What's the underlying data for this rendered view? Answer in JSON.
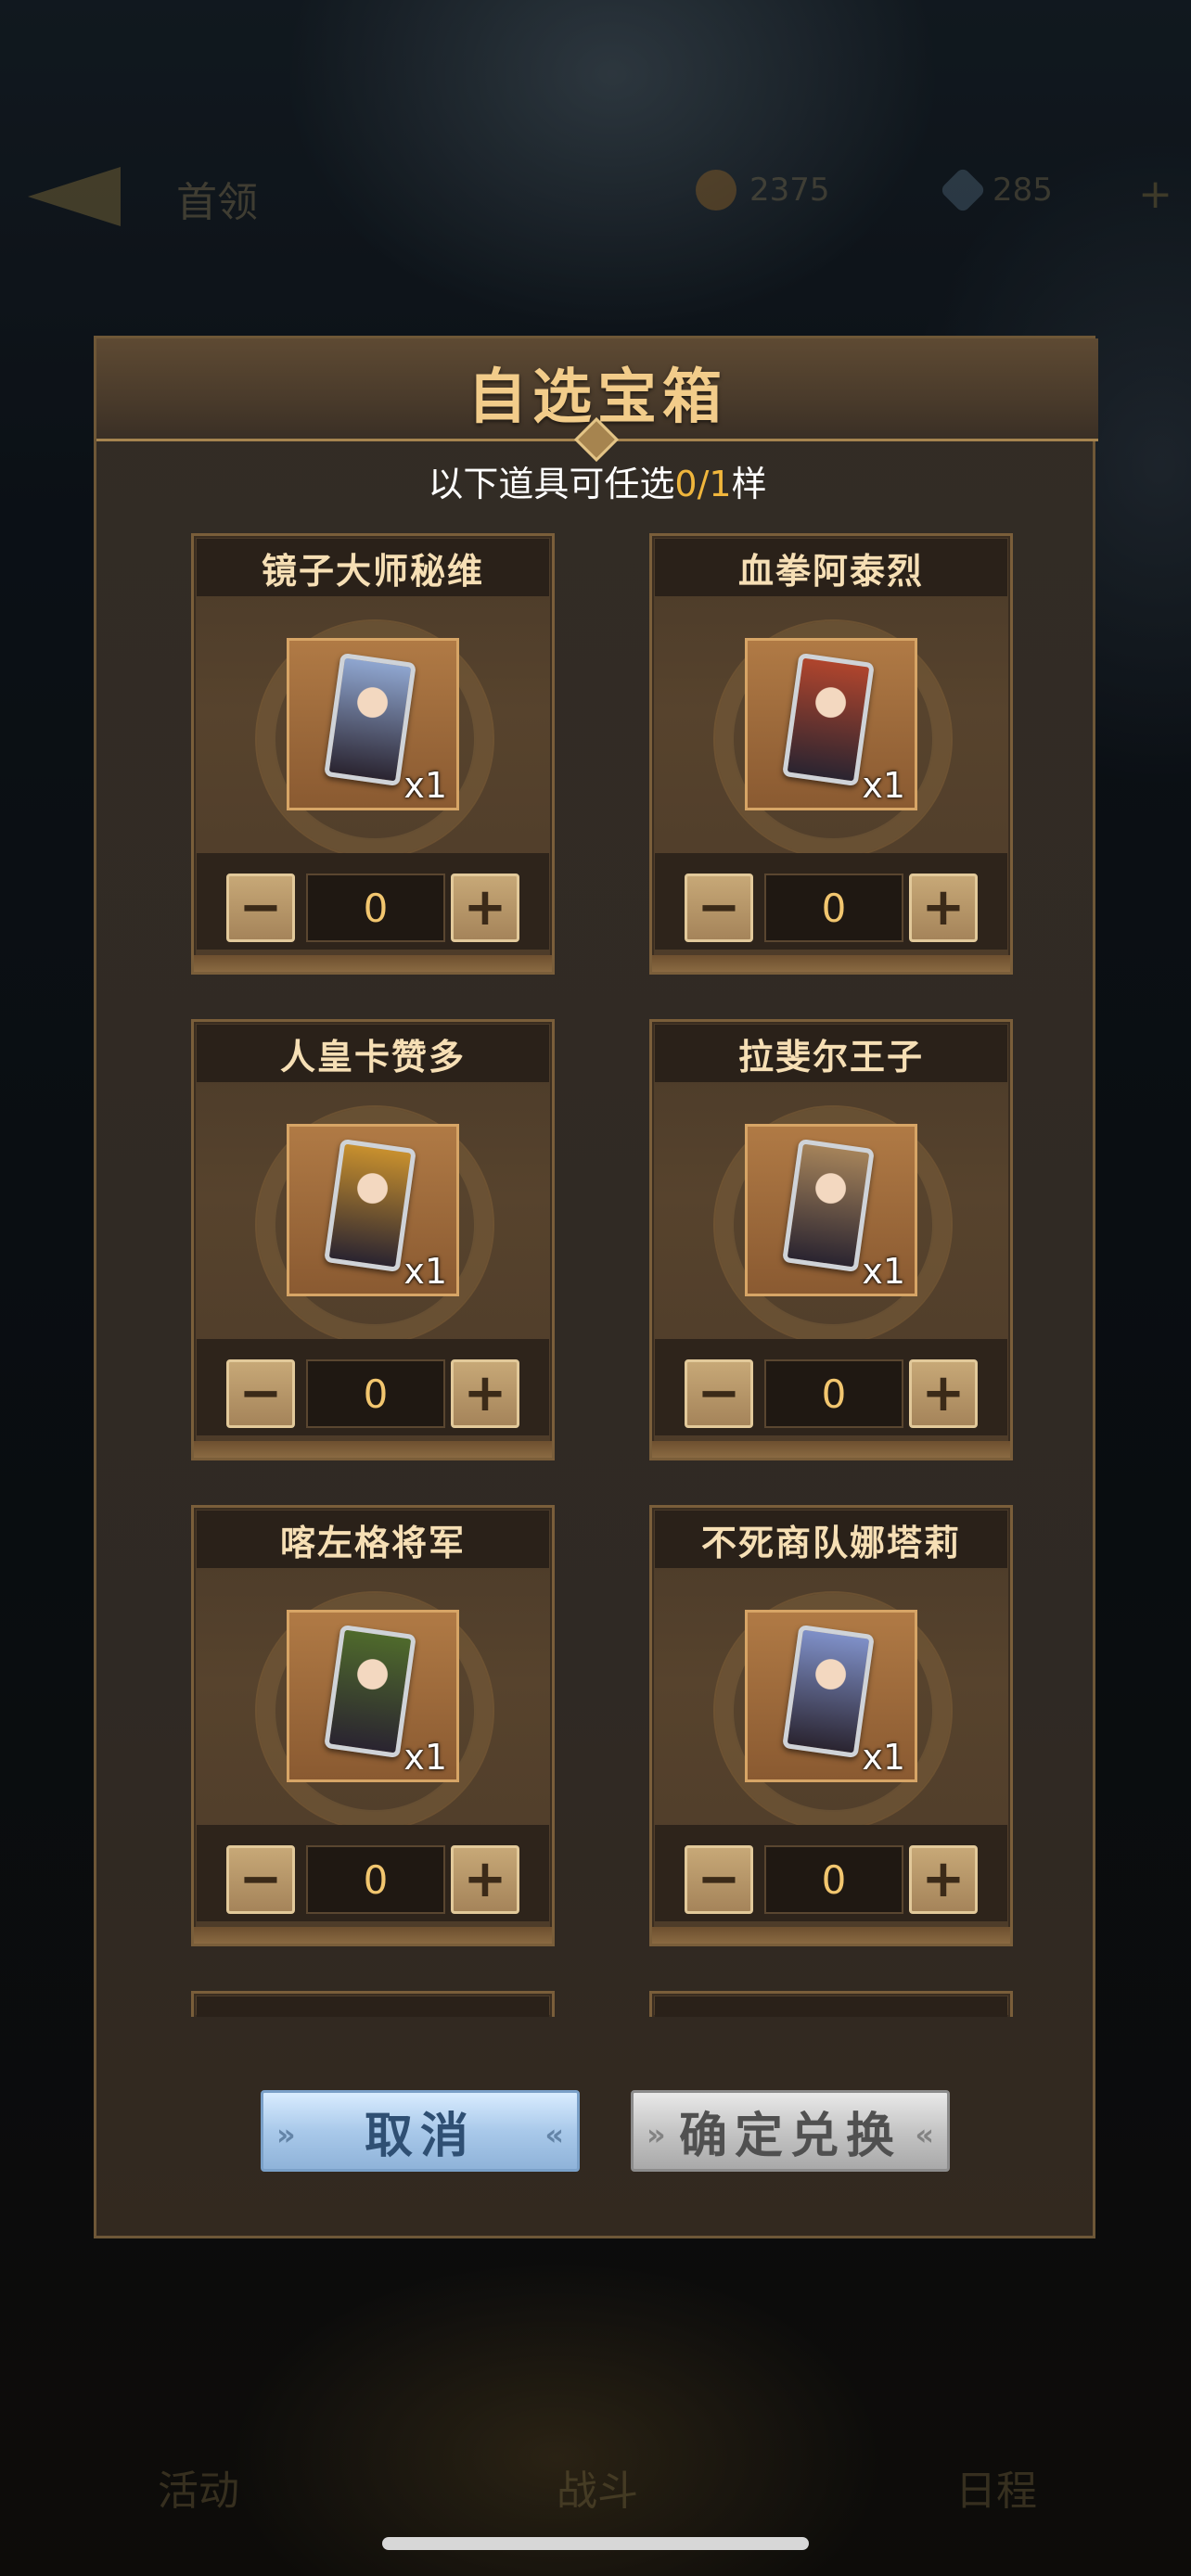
{
  "background": {
    "back_label": "首领",
    "resources": [
      "2375",
      "285"
    ],
    "nav": [
      "活动",
      "战斗",
      "日程"
    ]
  },
  "dialog": {
    "title": "自选宝箱",
    "subtitle_prefix": "以下道具可任选",
    "subtitle_count": "0/1",
    "subtitle_suffix": "样",
    "items": [
      {
        "name": "镜子大师秘维",
        "qty": "x1",
        "value": "0",
        "art": "#8fa6d0"
      },
      {
        "name": "血拳阿泰烈",
        "qty": "x1",
        "value": "0",
        "art": "#b0452d"
      },
      {
        "name": "人皇卡赞多",
        "qty": "x1",
        "value": "0",
        "art": "#c8902e"
      },
      {
        "name": "拉斐尔王子",
        "qty": "x1",
        "value": "0",
        "art": "#a5835a"
      },
      {
        "name": "喀左格将军",
        "qty": "x1",
        "value": "0",
        "art": "#4f6a2c"
      },
      {
        "name": "不死商队娜塔莉",
        "qty": "x1",
        "value": "0",
        "art": "#7f90c8"
      }
    ],
    "minus_label": "−",
    "plus_label": "+",
    "cancel_label": "取消",
    "confirm_label": "确定兑换"
  },
  "colors": {
    "accent_gold": "#f0b63c",
    "title_gold": "#f2cc8a",
    "cancel_blue": "#a9c9ea",
    "confirm_gray": "#c5c5c5"
  }
}
